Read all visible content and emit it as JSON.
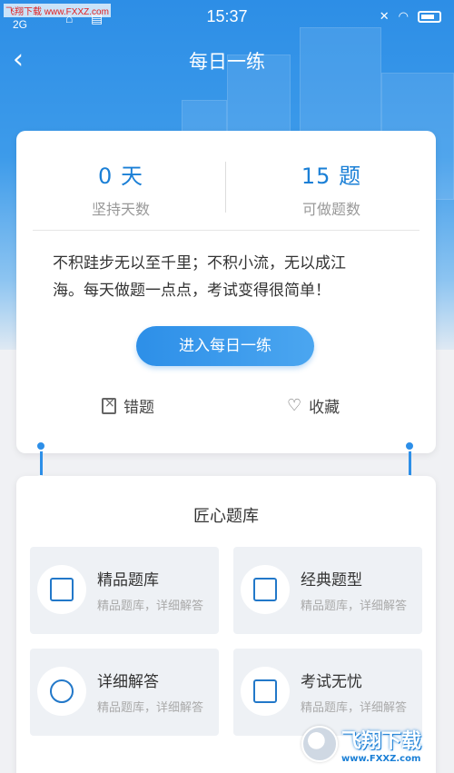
{
  "watermark_top": "飞翔下载 www.FXXZ.com",
  "status": {
    "network": "2G",
    "time": "15:37"
  },
  "nav": {
    "back_glyph": "‹",
    "title": "每日一练"
  },
  "stats": [
    {
      "value": "0 天",
      "label": "坚持天数"
    },
    {
      "value": "15 题",
      "label": "可做题数"
    }
  ],
  "quote_line1": "不积跬步无以至千里；不积小流，无以成江",
  "quote_line2": "海。每天做题一点点，考试变得很简单！",
  "enter_button": "进入每日一练",
  "actions": {
    "wrong": "错题",
    "favorite": "收藏"
  },
  "section_title": "匠心题库",
  "tiles": [
    {
      "name": "精品题库",
      "desc": "精品题库，详细解答"
    },
    {
      "name": "经典题型",
      "desc": "精品题库，详细解答"
    },
    {
      "name": "详细解答",
      "desc": "精品题库，详细解答"
    },
    {
      "name": "考试无忧",
      "desc": "精品题库，详细解答"
    }
  ],
  "logo_watermark": {
    "big": "飞翔下载",
    "small": "www.FXXZ.com"
  },
  "colors": {
    "accent": "#2d8fe8",
    "hero_top": "#2d8ee6",
    "page_bg": "#f0f1f4"
  }
}
